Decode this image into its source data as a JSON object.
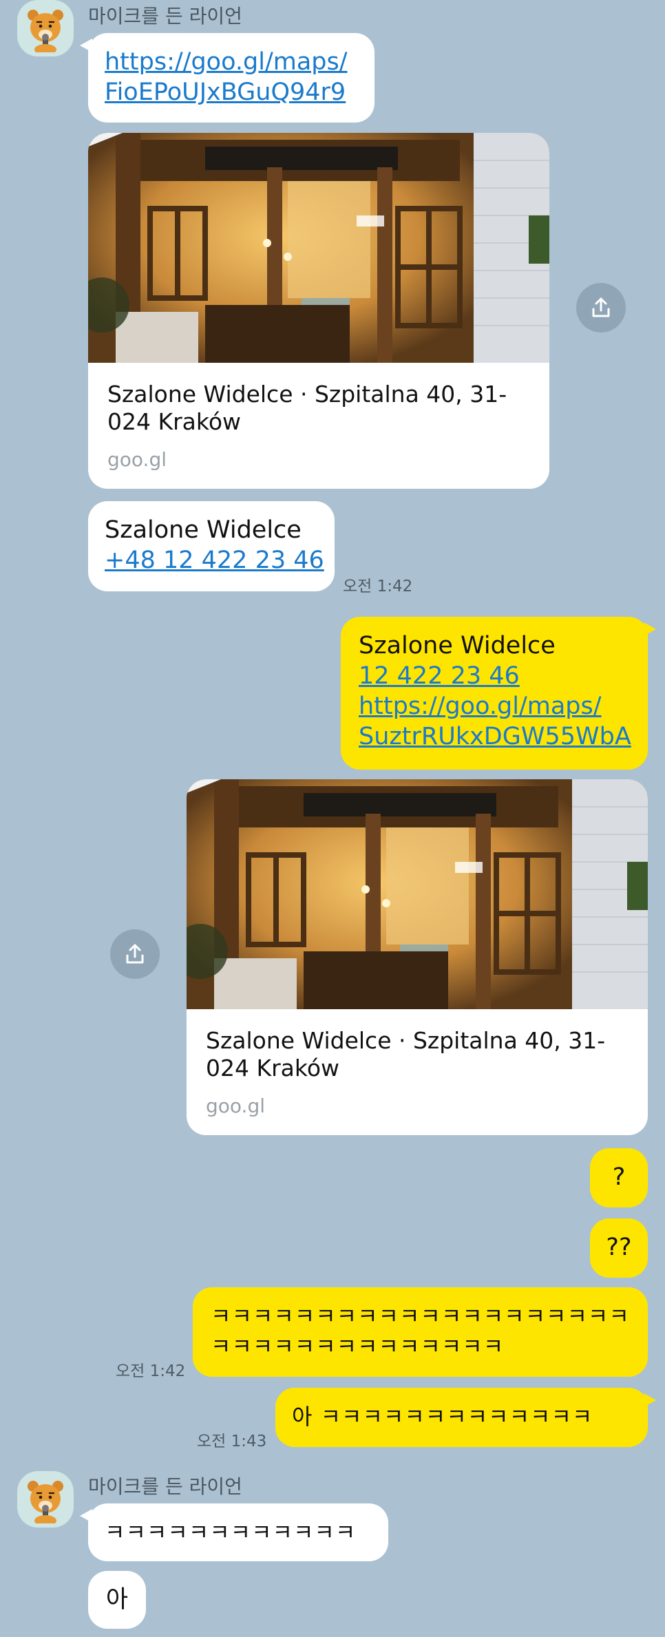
{
  "colors": {
    "background": "#abc1d1",
    "my_bubble": "#fee500",
    "their_bubble": "#ffffff",
    "link": "#1a7acb"
  },
  "chat": {
    "sender_name": "마이크를 든 라이언",
    "msg1_link_line1": "https://goo.gl/maps/",
    "msg1_link_line2": "FioEPoUJxBGuQ94r9",
    "preview1_title": "Szalone Widelce · Szpitalna 40, 31-024 Kraków",
    "preview1_domain": "goo.gl",
    "msg2_name": "Szalone Widelce",
    "msg2_phone": "+48 12 422 23 46",
    "msg2_time": "오전 1:42",
    "msg3_name": "Szalone Widelce",
    "msg3_phone": "12 422 23 46",
    "msg3_link_line1": "https://goo.gl/maps/",
    "msg3_link_line2": "SuztrRUkxDGW55WbA",
    "preview2_title": "Szalone Widelce · Szpitalna 40, 31-024 Kraków",
    "preview2_domain": "goo.gl",
    "msg4_text": "?",
    "msg5_text": "??",
    "msg6_line1": "ㅋㅋㅋㅋㅋㅋㅋㅋㅋㅋㅋㅋㅋㅋㅋㅋㅋㅋㅋㅋ",
    "msg6_line2": "ㅋㅋㅋㅋㅋㅋㅋㅋㅋㅋㅋㅋㅋㅋ",
    "msg6_time": "오전 1:42",
    "msg7_text": "아 ㅋㅋㅋㅋㅋㅋㅋㅋㅋㅋㅋㅋㅋ",
    "msg7_time": "오전 1:43",
    "sender2_name": "마이크를 든 라이언",
    "msg8_text": "ㅋㅋㅋㅋㅋㅋㅋㅋㅋㅋㅋㅋ",
    "msg9_text": "아"
  },
  "icons": {
    "avatar": "lion-avatar-icon",
    "share": "share-icon",
    "photo": "restaurant-photo"
  }
}
